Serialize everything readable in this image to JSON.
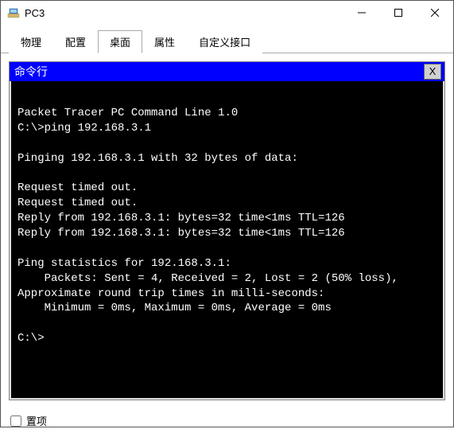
{
  "window": {
    "title": "PC3"
  },
  "tabs": {
    "t0": "物理",
    "t1": "配置",
    "t2": "桌面",
    "t3": "属性",
    "t4": "自定义接口",
    "active_index": 2
  },
  "cmd": {
    "title": "命令行",
    "close": "X",
    "lines": [
      "",
      "Packet Tracer PC Command Line 1.0",
      "C:\\>ping 192.168.3.1",
      "",
      "Pinging 192.168.3.1 with 32 bytes of data:",
      "",
      "Request timed out.",
      "Request timed out.",
      "Reply from 192.168.3.1: bytes=32 time<1ms TTL=126",
      "Reply from 192.168.3.1: bytes=32 time<1ms TTL=126",
      "",
      "Ping statistics for 192.168.3.1:",
      "    Packets: Sent = 4, Received = 2, Lost = 2 (50% loss),",
      "Approximate round trip times in milli-seconds:",
      "    Minimum = 0ms, Maximum = 0ms, Average = 0ms",
      "",
      "C:\\>"
    ]
  },
  "footer": {
    "checkbox_label": "置项"
  }
}
